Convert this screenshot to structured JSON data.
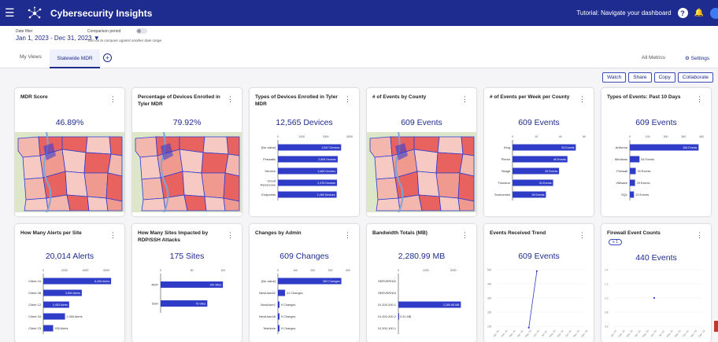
{
  "app": {
    "title": "Cybersecurity Insights",
    "tutorial": "Tutorial: Navigate your dashboard"
  },
  "filters": {
    "date_label": "Date filter",
    "date_value": "Jan 1, 2023 - Dec 31, 2023",
    "compare_label": "Comparison period",
    "compare_hint": "Turn on to compare against another date range",
    "compare_on": false
  },
  "tabs": {
    "my_views": "My Views",
    "statewide": "Statewide MDR",
    "all_metrics": "All Metrics",
    "settings": "Settings"
  },
  "actions": {
    "watch": "Watch",
    "share": "Share",
    "copy": "Copy",
    "collaborate": "Collaborate"
  },
  "colors": {
    "brand": "#1e2b8f",
    "bar": "#2f3cc8",
    "map_red": "#e8635f",
    "map_light": "#f6c9c2"
  },
  "cards": {
    "mdr_score": {
      "title": "MDR Score",
      "value": "46.89%"
    },
    "pct_enrolled": {
      "title": "Percentage of Devices Enrolled in Tyler MDR",
      "value": "79.92%"
    },
    "device_types": {
      "title": "Types of Devices Enrolled in Tyler MDR",
      "value": "12,565 Devices",
      "ticks": [
        "0",
        "1000",
        "2000",
        "3000"
      ],
      "max": 3000,
      "rows": [
        {
          "label": "[No value]",
          "value": 2647,
          "text": "2,647 Devices"
        },
        {
          "label": "Firewalls",
          "value": 2505,
          "text": "2,505 Devices"
        },
        {
          "label": "Servers",
          "value": 2480,
          "text": "2,480 Devices"
        },
        {
          "label": "Cloud Resources",
          "value": 2475,
          "text": "2,475 Devices"
        },
        {
          "label": "Endpoints",
          "value": 2459,
          "text": "2,459 Devices"
        }
      ]
    },
    "events_county": {
      "title": "# of Events by County",
      "value": "609 Events"
    },
    "events_week": {
      "title": "# of Events per Week per County",
      "value": "609 Events",
      "ticks": [
        "0",
        "20",
        "40",
        "60"
      ],
      "max": 60,
      "rows": [
        {
          "label": "King",
          "value": 53,
          "text": "53 Events"
        },
        {
          "label": "Pierce",
          "value": 46,
          "text": "46 Events"
        },
        {
          "label": "Skagit",
          "value": 39,
          "text": "39 Events"
        },
        {
          "label": "Thurston",
          "value": 34,
          "text": "34 Events"
        },
        {
          "label": "Snohomish",
          "value": 28,
          "text": "28 Events"
        }
      ]
    },
    "event_types": {
      "title": "Types of Events: Past 10 Days",
      "value": "609 Events",
      "ticks": [
        "0",
        "100",
        "200",
        "300",
        "400"
      ],
      "max": 400,
      "rows": [
        {
          "label": "Antivirus",
          "value": 384,
          "text": "384 Events"
        },
        {
          "label": "Windows",
          "value": 54,
          "text": "54 Events"
        },
        {
          "label": "Firewall",
          "value": 33,
          "text": "33 Events"
        },
        {
          "label": "VMware",
          "value": 29,
          "text": "29 Events"
        },
        {
          "label": "SQL",
          "value": 23,
          "text": "23 Events"
        }
      ]
    },
    "alerts_site": {
      "title": "How Many Alerts per Site",
      "value": "20,014 Alerts",
      "ticks": [
        "0",
        "2000",
        "4000",
        "6000"
      ],
      "max": 6800,
      "rows": [
        {
          "label": "Client 24",
          "value": 6436,
          "text": "6,436 Alerts"
        },
        {
          "label": "Client 38",
          "value": 3654,
          "text": "3,654 Alerts"
        },
        {
          "label": "Client 12",
          "value": 2453,
          "text": "2,453 Alerts"
        },
        {
          "label": "Client 34",
          "value": 2059,
          "text": "2,059 Alerts"
        },
        {
          "label": "Client 23",
          "value": 935,
          "text": "935 Alerts"
        }
      ]
    },
    "rdp_ssh": {
      "title": "How Many Sites Impacted by RDP/SSH Attacks",
      "value": "175 Sites",
      "ticks": [
        "0",
        "50",
        "100"
      ],
      "max": 115,
      "rows": [
        {
          "label": "RDP",
          "value": 100,
          "text": "100 Sites"
        },
        {
          "label": "SSH",
          "value": 75,
          "text": "75 Sites"
        }
      ]
    },
    "changes_admin": {
      "title": "Changes by Admin",
      "value": "609 Changes",
      "ticks": [
        "0",
        "100",
        "200",
        "300",
        "400"
      ],
      "max": 410,
      "rows": [
        {
          "label": "[No value]",
          "value": 363,
          "text": "363 Changes"
        },
        {
          "label": "NewUser62",
          "value": 41,
          "text": "41 Changes"
        },
        {
          "label": "NewUser1",
          "value": 9,
          "text": "9 Changes"
        },
        {
          "label": "NewUser46",
          "value": 9,
          "text": "9 Changes"
        },
        {
          "label": "Testdmin",
          "value": 9,
          "text": "9 Changes"
        }
      ]
    },
    "bandwidth": {
      "title": "Bandwidth Totals (MB)",
      "value": "2,280.99 MB",
      "ticks": [
        "0",
        "1000",
        "2000"
      ],
      "max": 2500,
      "rows": [
        {
          "label": "SERVER002",
          "value": 0,
          "text": ""
        },
        {
          "label": "SERVER004",
          "value": 0,
          "text": ""
        },
        {
          "label": "10.200.200.1",
          "value": 2280.68,
          "text": "2,280.68 MB"
        },
        {
          "label": "10.200.200.2",
          "value": 0.31,
          "text": "0.31 MB"
        },
        {
          "label": "10.200.100.1",
          "value": 0,
          "text": ""
        }
      ]
    },
    "events_trend": {
      "title": "Events Received Trend",
      "value": "609 Events",
      "yticks": [
        "100",
        "200",
        "300",
        "400",
        "500"
      ],
      "months": [
        "Jan",
        "Feb",
        "Mar",
        "Apr",
        "May",
        "Jun",
        "Jul",
        "Aug",
        "Sep",
        "Oct",
        "Nov",
        "Dec"
      ],
      "points": [
        {
          "month": "May",
          "value": 90
        },
        {
          "month": "Jun",
          "value": 490
        }
      ]
    },
    "firewall": {
      "title": "Firewall Event Counts",
      "chip": "1",
      "value": "440 Events",
      "yticks": [
        "0.6",
        "0.8",
        "1.0",
        "1.2",
        "1.4"
      ],
      "months": [
        "Jan",
        "Feb",
        "Mar",
        "Apr",
        "May",
        "Jun",
        "Jul",
        "Aug",
        "Sep",
        "Oct",
        "Nov",
        "Dec"
      ],
      "points": [
        {
          "month": "Jun",
          "value": 1
        }
      ]
    }
  }
}
